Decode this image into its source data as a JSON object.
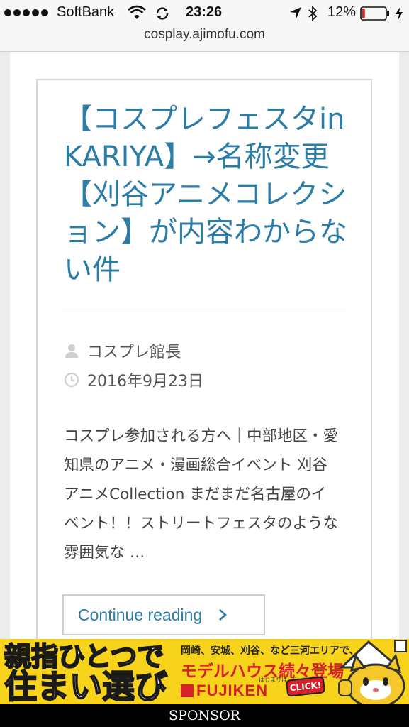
{
  "status_bar": {
    "carrier": "SoftBank",
    "time": "23:26",
    "battery_percent": "12%",
    "battery_level": 0.12,
    "battery_color": "#e0252b",
    "icons": [
      "signal-dots",
      "wifi-icon",
      "sync-icon",
      "location-icon",
      "bluetooth-icon",
      "battery-icon",
      "charging-icon"
    ]
  },
  "browser": {
    "url": "cosplay.ajimofu.com"
  },
  "article": {
    "title": "【コスプレフェスタinKARIYA】→名称変更【刈谷アニメコレクション】が内容わからない件",
    "author": "コスプレ館長",
    "date": "2016年9月23日",
    "excerpt": "コスプレ参加される方へ｜中部地区・愛知県のアニメ・漫画総合イベント 刈谷アニメCollection まだまだ名古屋のイベント！！ストリートフェスタのような雰囲気な …",
    "continue_label": "Continue reading",
    "link_color": "#2b7ca6"
  },
  "ad": {
    "left_line1": "親指ひとつで",
    "left_line2": "住まい選び",
    "right_top": "岡崎、安城、刈谷、など三河エリアで、",
    "headline": "モデルハウス続々登場",
    "small_text": "はじまりは、Smileから。",
    "brand": "FUJIKEN",
    "click_label": "CLICK!",
    "background_color": "#f7d31c"
  },
  "sponsor_label": "SPONSOR"
}
